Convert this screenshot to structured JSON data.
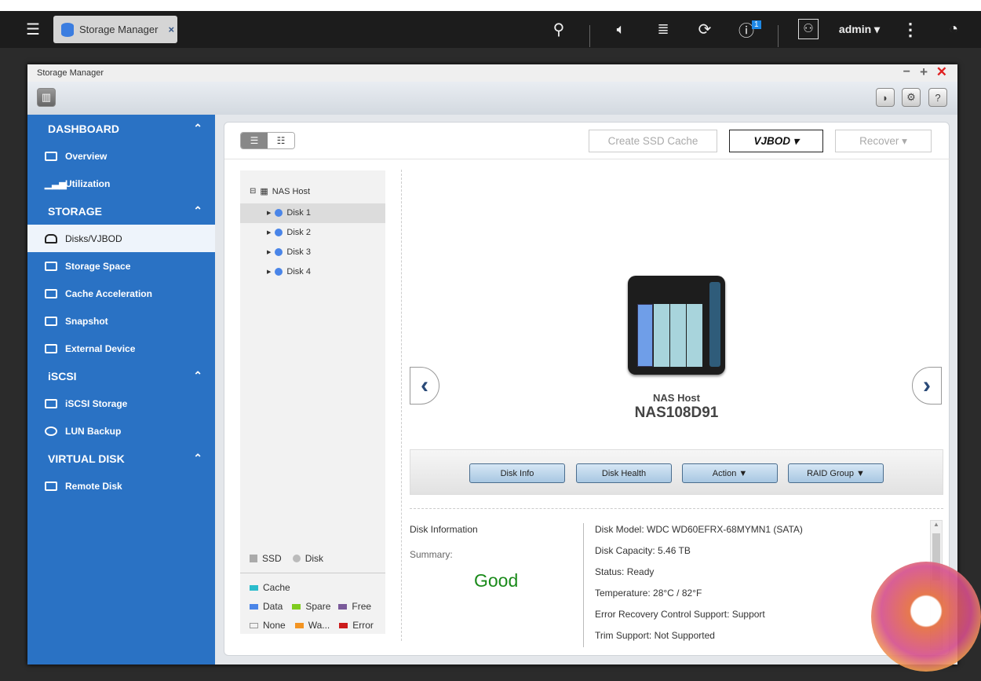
{
  "taskbar": {
    "app_tab": "Storage Manager",
    "user": "admin ▾",
    "notification_count": "1"
  },
  "window": {
    "title": "Storage Manager"
  },
  "sidebar": {
    "sections": [
      {
        "label": "DASHBOARD",
        "items": [
          "Overview",
          "Utilization"
        ]
      },
      {
        "label": "STORAGE",
        "items": [
          "Disks/VJBOD",
          "Storage Space",
          "Cache Acceleration",
          "Snapshot",
          "External Device"
        ]
      },
      {
        "label": "iSCSI",
        "items": [
          "iSCSI Storage",
          "LUN Backup"
        ]
      },
      {
        "label": "VIRTUAL DISK",
        "items": [
          "Remote Disk"
        ]
      }
    ],
    "selected": "Disks/VJBOD"
  },
  "toolbar": {
    "create_ssd_cache": "Create SSD Cache",
    "vjbod": "VJBOD ▾",
    "recover": "Recover ▾"
  },
  "tree": {
    "root": "NAS Host",
    "disks": [
      "Disk 1",
      "Disk 2",
      "Disk 3",
      "Disk 4"
    ]
  },
  "legend": {
    "ssd": "SSD",
    "disk": "Disk",
    "cache": "Cache",
    "data": "Data",
    "spare": "Spare",
    "free": "Free",
    "none": "None",
    "warning": "Wa...",
    "error": "Error",
    "colors": {
      "cache": "#2bbccc",
      "data": "#4a85e8",
      "spare": "#7fcc1e",
      "free": "#7a5a9a",
      "warning": "#f39422",
      "error": "#cc1c1c"
    }
  },
  "device": {
    "label": "NAS Host",
    "name": "NAS108D91"
  },
  "actions": [
    "Disk Info",
    "Disk Health",
    "Action ▼",
    "RAID Group ▼"
  ],
  "disk_info": {
    "heading": "Disk Information",
    "summary_label": "Summary:",
    "summary": "Good",
    "details": [
      "Disk Model: WDC WD60EFRX-68MYMN1 (SATA)",
      "Disk Capacity: 5.46 TB",
      "Status: Ready",
      "Temperature: 28°C / 82°F",
      "Error Recovery Control Support: Support",
      "Trim Support: Not Supported"
    ]
  }
}
